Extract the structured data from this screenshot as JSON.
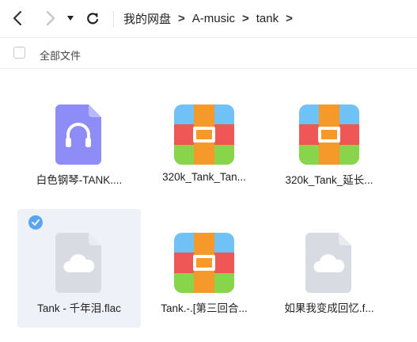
{
  "toolbar": {
    "back_icon": "chevron-left-icon",
    "forward_icon": "chevron-right-icon",
    "history_icon": "caret-down-icon",
    "refresh_icon": "refresh-icon",
    "breadcrumbs": [
      "我的网盘",
      "A-music",
      "tank"
    ],
    "crumb_separator": ">"
  },
  "selection": {
    "select_all_label": "全部文件"
  },
  "files": [
    {
      "name": "白色钢琴-TANK....",
      "icon": "audio-file-icon",
      "selected": false
    },
    {
      "name": "320k_Tank_Tan...",
      "icon": "archive-file-icon",
      "selected": false
    },
    {
      "name": "320k_Tank_延长...",
      "icon": "archive-file-icon",
      "selected": false
    },
    {
      "name": "Tank - 千年泪.flac",
      "icon": "cloud-file-icon",
      "selected": true
    },
    {
      "name": "Tank.-.[第三回合...",
      "icon": "archive-file-icon",
      "selected": false
    },
    {
      "name": "如果我变成回忆.f...",
      "icon": "cloud-file-icon",
      "selected": false
    }
  ],
  "colors": {
    "accent": "#5aa4f4",
    "audio_icon": "#8e8df7",
    "cloud_icon": "#d8dbe1",
    "selected_bg": "#eef1f7"
  }
}
